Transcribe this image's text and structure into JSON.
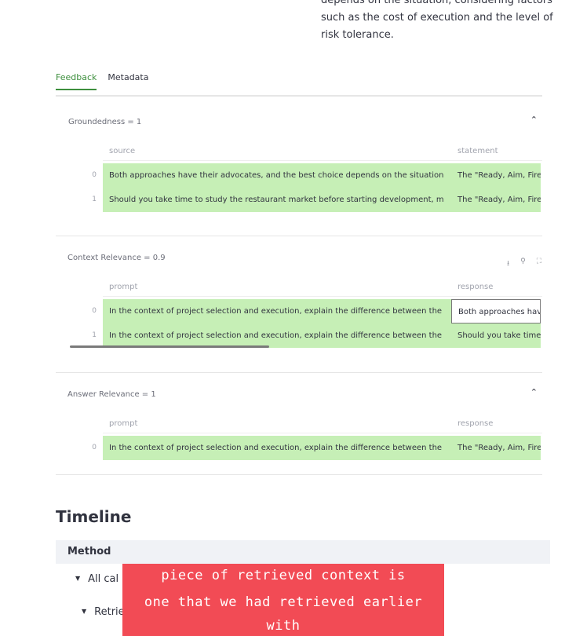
{
  "response_tail": {
    "lines": [
      "depends on the situation, considering factors",
      "such as the cost of execution and the level of",
      "risk tolerance."
    ]
  },
  "tabs": [
    {
      "label": "Feedback",
      "active": true
    },
    {
      "label": "Metadata",
      "active": false
    }
  ],
  "groundedness": {
    "title": "Groundedness = 1",
    "columns": [
      "source",
      "statement"
    ],
    "rows": [
      {
        "index": "0",
        "source": "Both approaches have their advocates, and the best choice depends on the situation",
        "statement": "The \"Ready, Aim, Fire"
      },
      {
        "index": "1",
        "source": "Should you take time to study the restaurant market before starting development, m",
        "statement": "The \"Ready, Aim, Fire"
      }
    ]
  },
  "context_relevance": {
    "title": "Context Relevance = 0.9",
    "columns": [
      "prompt",
      "response"
    ],
    "toolbar_icons": [
      "download-icon",
      "search-icon",
      "fullscreen-icon"
    ],
    "rows": [
      {
        "index": "0",
        "prompt": "In the context of project selection and execution, explain the difference between the",
        "response": "Both approaches hav"
      },
      {
        "index": "1",
        "prompt": "In the context of project selection and execution, explain the difference between the",
        "response": "Should you take time"
      }
    ]
  },
  "answer_relevance": {
    "title": "Answer Relevance = 1",
    "columns": [
      "prompt",
      "response"
    ],
    "rows": [
      {
        "index": "0",
        "prompt": "In the context of project selection and execution, explain the difference between the",
        "response": "The \"Ready, Aim, Fire"
      }
    ]
  },
  "timeline": {
    "title": "Timeline",
    "method_header": "Method",
    "tree_item_1": "All cal",
    "tree_item_2": "Retrieve.QueryEngine.query"
  },
  "caption": {
    "line1": "piece of retrieved context is similar to the",
    "line2": "one that we had retrieved earlier with"
  },
  "colors": {
    "accent": "#3d8f3d",
    "row_highlight": "#c6efb6",
    "caption_bg": "#f24b55"
  }
}
